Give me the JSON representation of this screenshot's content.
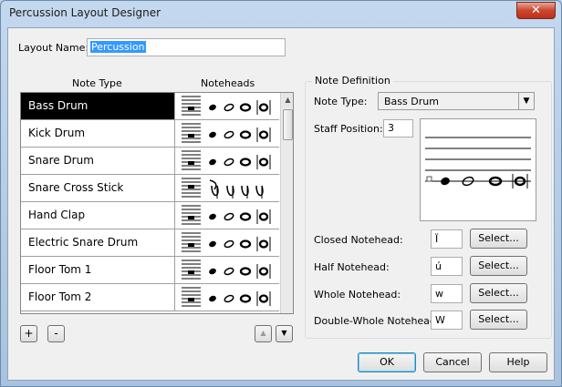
{
  "window": {
    "title": "Percussion Layout Designer",
    "close_glyph": "✕"
  },
  "layout_name": {
    "label": "Layout Name:",
    "value": "Percussion"
  },
  "table": {
    "col_note_type": "Note Type",
    "col_noteheads": "Noteheads",
    "rows": [
      {
        "name": "Bass Drum",
        "selected": true,
        "style": "oval"
      },
      {
        "name": "Kick Drum",
        "style": "oval"
      },
      {
        "name": "Snare Drum",
        "style": "oval"
      },
      {
        "name": "Snare Cross Stick",
        "style": "cross"
      },
      {
        "name": "Hand Clap",
        "style": "oval"
      },
      {
        "name": "Electric Snare Drum",
        "style": "oval"
      },
      {
        "name": "Floor Tom 1",
        "style": "oval"
      },
      {
        "name": "Floor Tom 2",
        "style": "oval"
      }
    ]
  },
  "buttons": {
    "add": "+",
    "remove": "-",
    "move_up": "▲",
    "move_down": "▼",
    "ok": "OK",
    "cancel": "Cancel",
    "help": "Help"
  },
  "note_definition": {
    "title": "Note Definition",
    "note_type_label": "Note Type:",
    "note_type_value": "Bass Drum",
    "staff_position_label": "Staff Position:",
    "staff_position_value": "3",
    "closed_label": "Closed Notehead:",
    "closed_value": "Ï",
    "half_label": "Half Notehead:",
    "half_value": "ú",
    "whole_label": "Whole Notehead:",
    "whole_value": "w",
    "double_whole_label": "Double-Whole Notehead:",
    "double_whole_value": "W",
    "select_label": "Select..."
  }
}
